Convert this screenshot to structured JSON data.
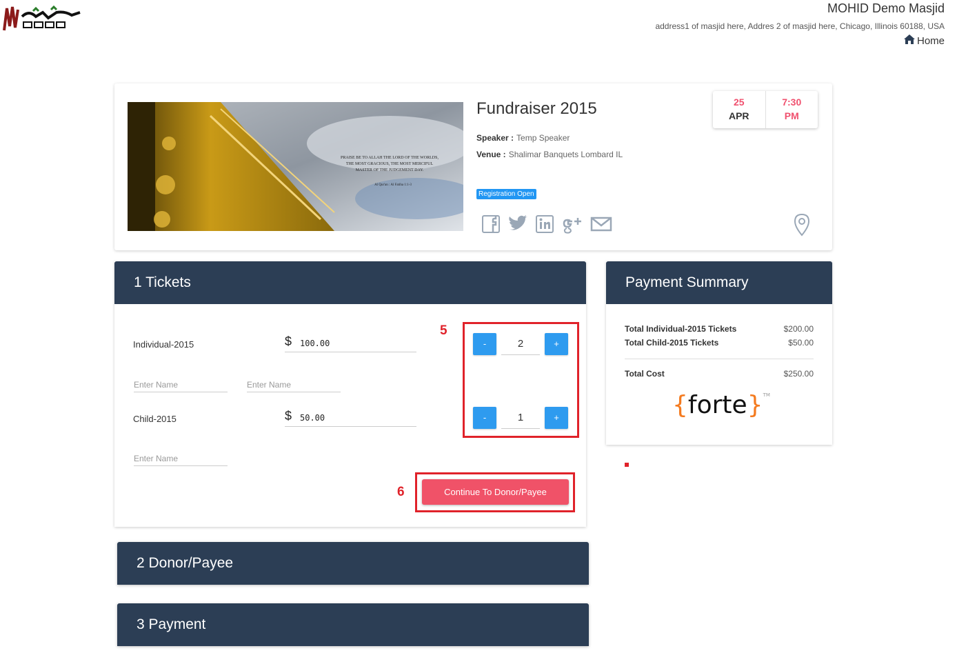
{
  "header": {
    "masjid_name": "MOHID Demo Masjid",
    "address": "address1 of masjid here, Addres 2 of masjid here, Chicago, Illinois 60188, USA",
    "home_label": "Home"
  },
  "event": {
    "title": "Fundraiser 2015",
    "speaker_label": "Speaker :",
    "speaker": "Temp Speaker",
    "venue_label": "Venue :",
    "venue": "Shalimar Banquets Lombard IL",
    "badge": "Registration Open",
    "image_text": "PRAISE BE TO ALLAH THE LORD OF THE WORLDS, THE MOST GRACIOUS, THE MOST MERCIFUL MASTER OF THE JUDGEMENT DAY.",
    "image_caption": "Al Qur'an : Al Fatiha 1:1-3",
    "date": {
      "day": "25",
      "month": "APR",
      "time": "7:30",
      "ampm": "PM"
    },
    "social_icons": [
      "facebook-icon",
      "twitter-icon",
      "linkedin-icon",
      "google-plus-icon",
      "mail-icon"
    ]
  },
  "tickets": {
    "heading": "1 Tickets",
    "items": [
      {
        "name": "Individual-2015",
        "currency": "$",
        "price": "100.00",
        "qty": "2",
        "name_placeholders": [
          "Enter Name",
          "Enter Name"
        ]
      },
      {
        "name": "Child-2015",
        "currency": "$",
        "price": "50.00",
        "qty": "1",
        "name_placeholders": [
          "Enter Name"
        ]
      }
    ],
    "minus_label": "-",
    "plus_label": "+",
    "continue_label": "Continue To Donor/Payee",
    "annotation_qty": "5",
    "annotation_btn": "6"
  },
  "summary": {
    "heading": "Payment Summary",
    "rows": [
      {
        "label": "Total Individual-2015 Tickets",
        "value": "$200.00"
      },
      {
        "label": "Total Child-2015 Tickets",
        "value": "$50.00"
      }
    ],
    "total_label": "Total Cost",
    "total_value": "$250.00",
    "logo_text": "forte",
    "logo_brace_open": "{",
    "logo_brace_close": "}",
    "logo_tm": "TM"
  },
  "donor": {
    "heading": "2 Donor/Payee"
  },
  "payment": {
    "heading": "3 Payment"
  },
  "colors": {
    "panel_header": "#2c3e55",
    "accent_blue": "#2e9bef",
    "accent_pink": "#f05268",
    "annotation_red": "#e0222a"
  }
}
